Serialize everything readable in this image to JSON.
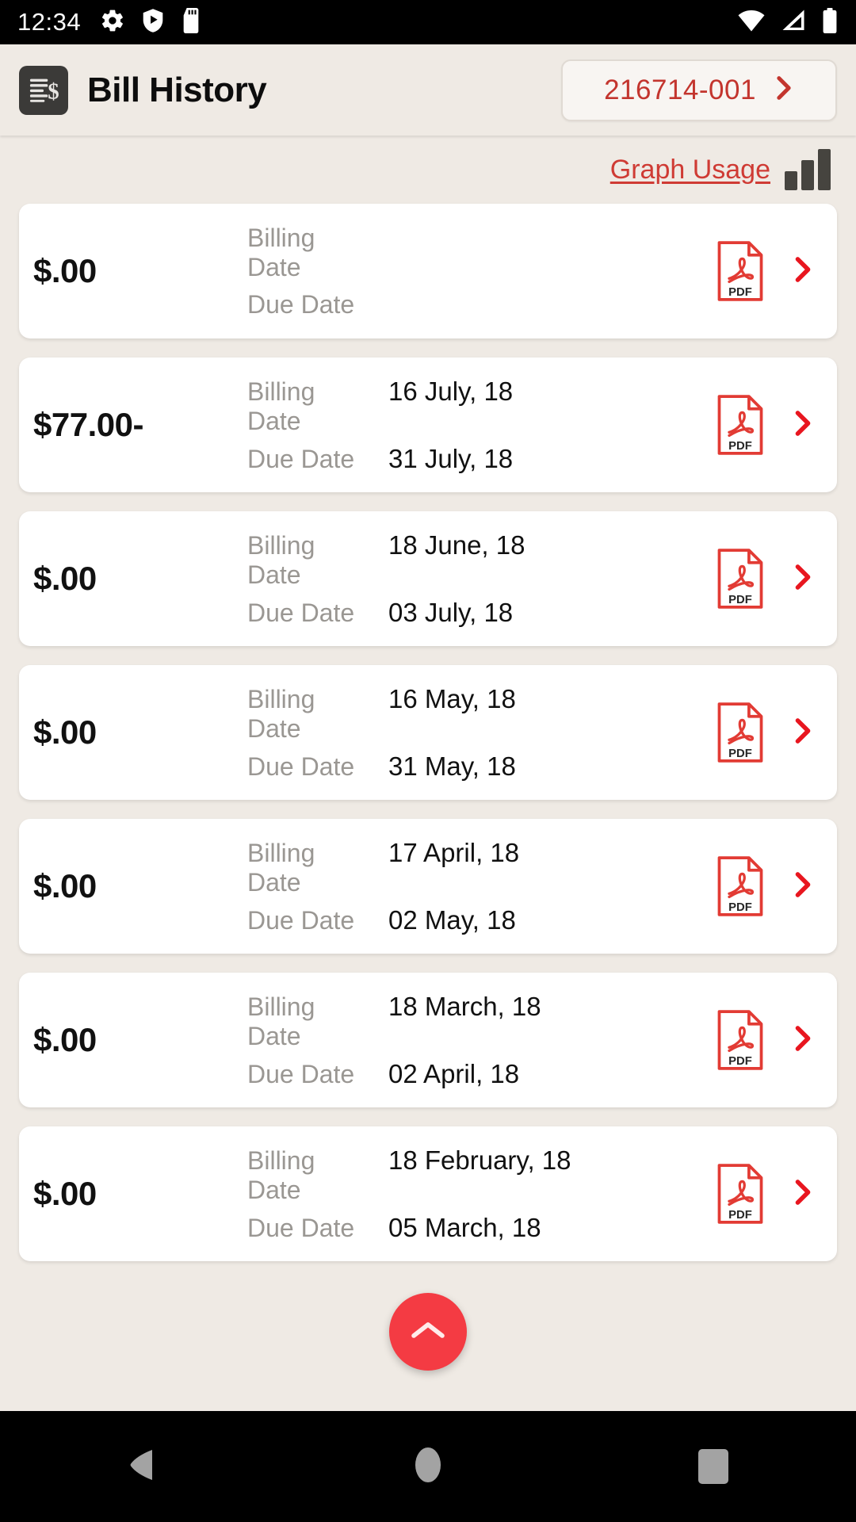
{
  "status_bar": {
    "time": "12:34",
    "left_icons": [
      "settings-gear-icon",
      "play-protect-shield-icon",
      "sd-card-icon"
    ],
    "right_icons": [
      "wifi-icon",
      "cellular-signal-icon",
      "battery-icon"
    ]
  },
  "header": {
    "app_icon": "bill-document-dollar-icon",
    "title": "Bill History",
    "account": {
      "number": "216714-001",
      "chevron": "chevron-right-icon"
    }
  },
  "toolbar": {
    "graph_usage_label": "Graph Usage",
    "graph_icon": "bar-chart-icon"
  },
  "labels": {
    "billing_date": "Billing Date",
    "due_date": "Due Date",
    "pdf_label": "PDF"
  },
  "bills": [
    {
      "amount": "$.00",
      "billing_date": "",
      "due_date": ""
    },
    {
      "amount": "$77.00-",
      "billing_date": "16 July, 18",
      "due_date": "31 July, 18"
    },
    {
      "amount": "$.00",
      "billing_date": "18 June, 18",
      "due_date": "03 July, 18"
    },
    {
      "amount": "$.00",
      "billing_date": "16 May, 18",
      "due_date": "31 May, 18"
    },
    {
      "amount": "$.00",
      "billing_date": "17 April, 18",
      "due_date": "02 May, 18"
    },
    {
      "amount": "$.00",
      "billing_date": "18 March, 18",
      "due_date": "02 April, 18"
    },
    {
      "amount": "$.00",
      "billing_date": "18 February, 18",
      "due_date": "05 March, 18"
    }
  ],
  "fab": {
    "icon": "chevron-up-icon"
  },
  "nav_bar": {
    "back": "back-triangle-icon",
    "home": "home-circle-icon",
    "recents": "recents-square-icon"
  },
  "colors": {
    "background": "#efeae4",
    "card": "#ffffff",
    "accent_red": "#cf3b34",
    "fab_red": "#f43b43",
    "muted_text": "#9a9793",
    "icon_dark": "#3b3a38"
  }
}
